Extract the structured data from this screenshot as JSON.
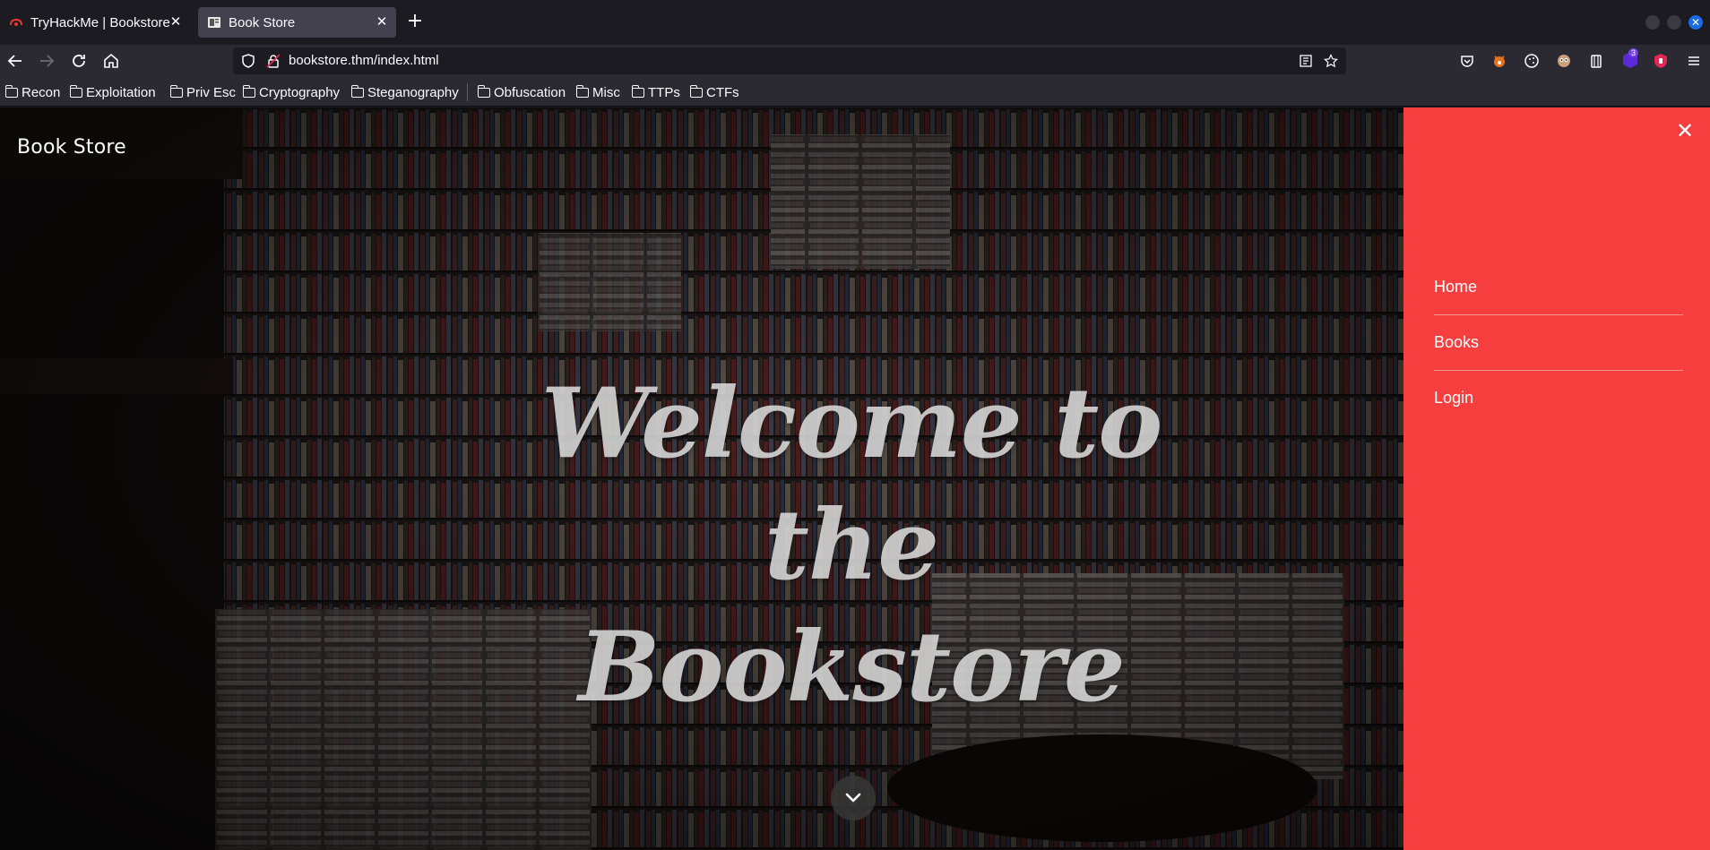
{
  "browser": {
    "tabs": [
      {
        "title": "TryHackMe | Bookstore",
        "active": false
      },
      {
        "title": "Book Store",
        "active": true
      }
    ],
    "url": "bookstore.thm/index.html",
    "bookmarks": [
      "Recon",
      "Exploitation",
      "Priv Esc",
      "Cryptography",
      "Steganography",
      "Obfuscation",
      "Misc",
      "TTPs",
      "CTFs"
    ],
    "extension_badge": "3",
    "icons": {
      "back": "arrow-left-icon",
      "forward": "arrow-right-icon",
      "reload": "reload-icon",
      "home": "home-icon",
      "shield": "shield-icon",
      "lock": "lock-icon",
      "reader": "reader-view-icon",
      "star": "bookmark-star-icon",
      "menu": "hamburger-menu-icon"
    }
  },
  "page": {
    "brand": "Book Store",
    "headline_line1": "Welcome to the",
    "headline_line2": "Bookstore",
    "menu": {
      "items": [
        "Home",
        "Books",
        "Login"
      ],
      "close_icon": "close-icon"
    },
    "scroll_icon": "chevron-down-icon"
  },
  "colors": {
    "menu_background": "#f63e3f",
    "browser_chrome": "#2b2a33",
    "tabstrip": "#1c1b22"
  }
}
